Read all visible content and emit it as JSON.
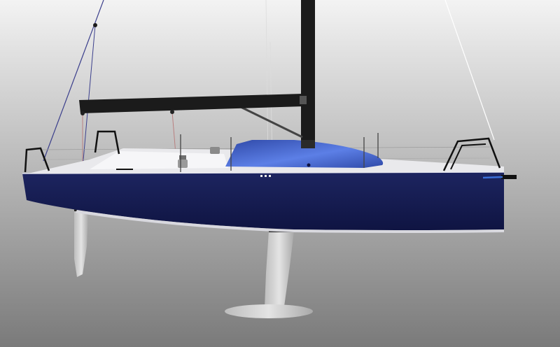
{
  "scene": {
    "subject": "sailboat-render",
    "colors": {
      "background_top": "#f3f3f3",
      "background_bottom": "#7a7a7a",
      "hull": "#0f1442",
      "hull_highlight": "#1d2560",
      "deck": "#e9e9ec",
      "cabin": "#2f49a8",
      "cabin_highlight": "#5c7fe6",
      "spar": "#1b1b1b",
      "foil": "#e4e4e4",
      "rigging": "#ffffff",
      "stay": "#3b3f8c",
      "accent": "#3b6fd8"
    }
  }
}
